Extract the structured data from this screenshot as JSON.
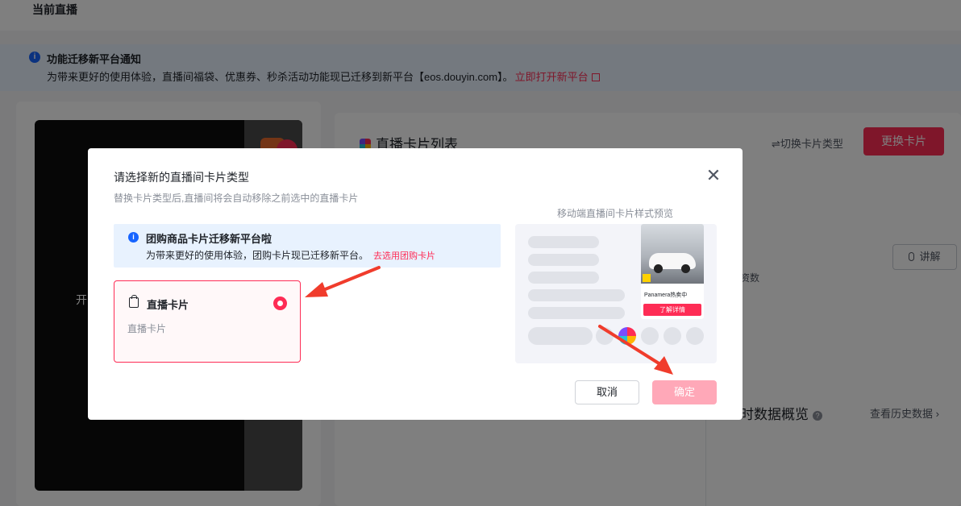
{
  "page": {
    "title": "当前直播"
  },
  "notice": {
    "title": "功能迁移新平台通知",
    "text": "为带来更好的使用体验，直播间福袋、优惠券、秒杀活动功能现已迁移到新平台【eos.douyin.com】。",
    "link": "立即打开新平台"
  },
  "video": {
    "text": "开"
  },
  "card_list": {
    "title": "直播卡片列表",
    "switch_type": "⇌切换卡片类型",
    "change_button": "更换卡片",
    "explain_button": "讲解",
    "partial_text": "资数"
  },
  "data_overview": {
    "title": "时数据概览",
    "history_link": "查看历史数据"
  },
  "modal": {
    "title": "请选择新的直播间卡片类型",
    "subtitle": "替换卡片类型后,直播间将会自动移除之前选中的直播卡片",
    "info": {
      "title": "团购商品卡片迁移新平台啦",
      "text": "为带来更好的使用体验，团购卡片现已迁移新平台。",
      "link": "去选用团购卡片"
    },
    "option": {
      "title": "直播卡片",
      "desc": "直播卡片",
      "selected": true
    },
    "preview": {
      "label": "移动端直播间卡片样式预览",
      "product_name": "Panamera热卖中",
      "product_button": "了解详情"
    },
    "cancel_button": "取消",
    "confirm_button": "确定"
  },
  "colors": {
    "brand": "#fe2c55",
    "info_blue": "#1664ff",
    "confirm_disabled": "#ffa8b8"
  }
}
